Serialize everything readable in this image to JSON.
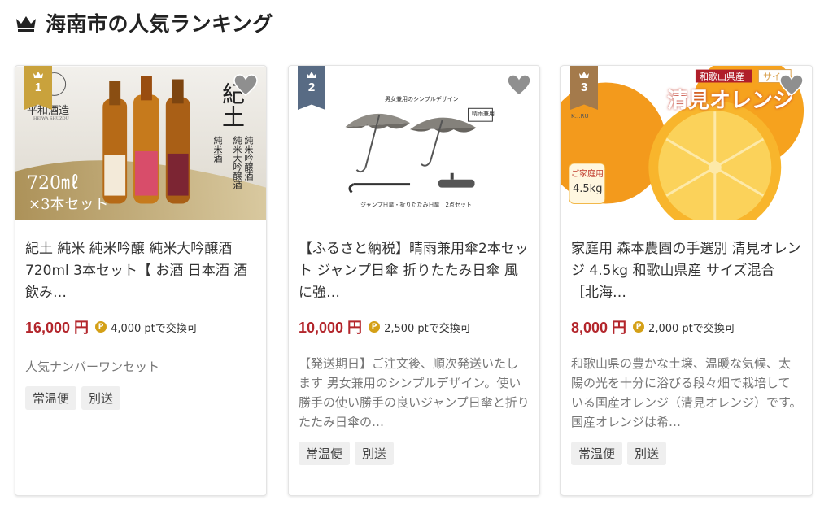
{
  "section": {
    "title": "海南市の人気ランキング",
    "icon": "crown-icon"
  },
  "colors": {
    "price": "#b3262c",
    "rank_gold": "#c9a23c",
    "rank_blue": "#586b84",
    "rank_bronze": "#a47a4b"
  },
  "cards": [
    {
      "rank": "1",
      "title": "紀土 純米 純米吟醸 純米大吟醸酒 720ml 3本セット【 お酒 日本酒 酒 飲み…",
      "price": "16,000 円",
      "points": "4,000 ptで交換可",
      "description": "人気ナンバーワンセット",
      "tags": [
        "常温便",
        "別送"
      ],
      "image_text": {
        "brand": "平和酒造",
        "brand_en": "HEIWA SHUZOU",
        "name": "紀土",
        "col1": "純米吟醸酒",
        "col2": "純米大吟醸酒",
        "col3": "純米酒",
        "volume": "720㎖",
        "set": "×3本セット"
      }
    },
    {
      "rank": "2",
      "title": "【ふるさと納税】晴雨兼用傘2本セット ジャンプ日傘 折りたたみ日傘 風に強…",
      "price": "10,000 円",
      "points": "2,500 ptで交換可",
      "description": "【発送期日】ご注文後、順次発送いたします 男女兼用のシンプルデザイン。使い勝手の使い勝手の良いジャンプ日傘と折りたたみ日傘の…",
      "tags": [
        "常温便",
        "別送"
      ],
      "image_text": {
        "top": "男女兼用のシンプルデザイン",
        "badge": "晴雨兼用",
        "bottom": "ジャンプ日傘・折りたたみ日傘　2点セット"
      }
    },
    {
      "rank": "3",
      "title": "家庭用 森本農園の手選別 清見オレンジ 4.5kg 和歌山県産 サイズ混合［北海…",
      "price": "8,000 円",
      "points": "2,000 ptで交換可",
      "description": "和歌山県の豊かな土壌、温暖な気候、太陽の光を十分に浴びる段々畑で栽培している国産オレンジ（清見オレンジ）です。国産オレンジは希…",
      "tags": [
        "常温便",
        "別送"
      ],
      "image_text": {
        "region": "和歌山県産",
        "size": "サイ",
        "name": "清見オレンジ",
        "home": "ご家庭用",
        "weight": "4.5kg",
        "farm": "K…RU"
      }
    }
  ]
}
